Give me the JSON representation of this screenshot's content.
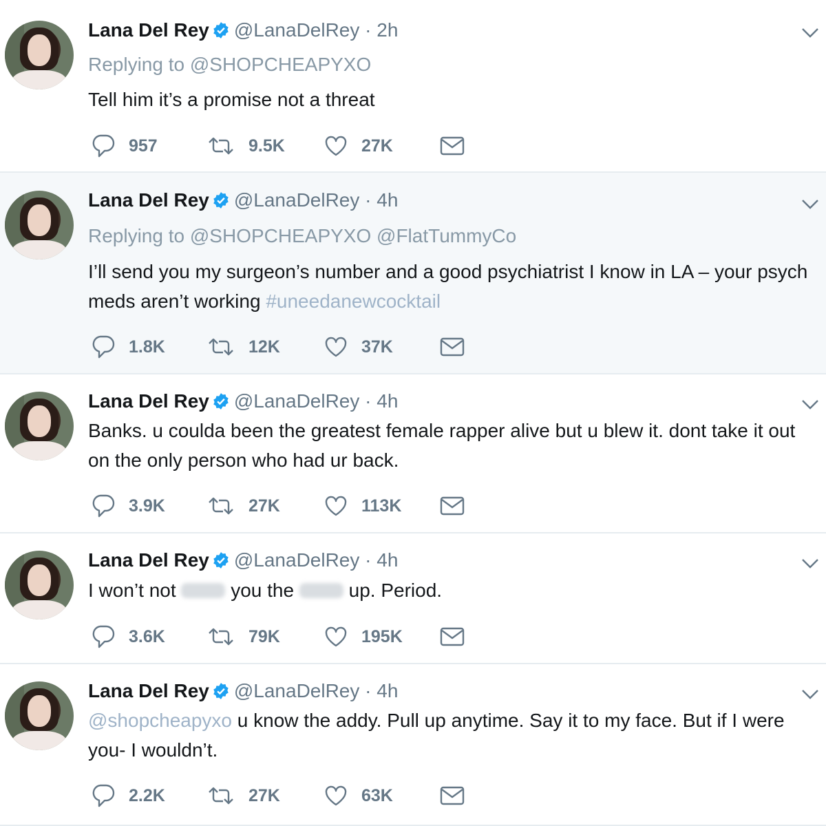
{
  "tweets": [
    {
      "name": "Lana Del Rey",
      "handle": "@LanaDelRey",
      "separator": "·",
      "time": "2h",
      "replying_prefix": "Replying to",
      "replying_to": "@SHOPCHEAPYXO",
      "text": "Tell him it’s a promise not a threat",
      "replies": "957",
      "retweets": "9.5K",
      "likes": "27K"
    },
    {
      "name": "Lana Del Rey",
      "handle": "@LanaDelRey",
      "separator": "·",
      "time": "4h",
      "replying_prefix": "Replying to",
      "replying_to": "@SHOPCHEAPYXO @FlatTummyCo",
      "text": "I’ll send you my surgeon’s number and a good psychiatrist I know in LA – your psych meds aren’t working",
      "hashtag": "#uneedanewcocktail",
      "replies": "1.8K",
      "retweets": "12K",
      "likes": "37K"
    },
    {
      "name": "Lana Del Rey",
      "handle": "@LanaDelRey",
      "separator": "·",
      "time": "4h",
      "text": "Banks. u coulda been the greatest female rapper alive but u blew it. dont take it out on the only person who had ur back.",
      "replies": "3.9K",
      "retweets": "27K",
      "likes": "113K"
    },
    {
      "name": "Lana Del Rey",
      "handle": "@LanaDelRey",
      "separator": "·",
      "time": "4h",
      "text_part1": "I won’t not",
      "text_part2": "you the",
      "text_part3": "up. Period.",
      "replies": "3.6K",
      "retweets": "79K",
      "likes": "195K"
    },
    {
      "name": "Lana Del Rey",
      "handle": "@LanaDelRey",
      "separator": "·",
      "time": "4h",
      "mention": "@shopcheapyxo",
      "text": "u know the addy. Pull up anytime. Say it to my face. But if I were you- I wouldn’t.",
      "replies": "2.2K",
      "retweets": "27K",
      "likes": "63K"
    }
  ],
  "icons": {
    "reply": "reply-icon",
    "retweet": "retweet-icon",
    "like": "heart-icon",
    "dm": "envelope-icon",
    "verified": "verified-badge-icon",
    "menu": "chevron-down-icon"
  },
  "colors": {
    "verified_blue": "#1da1f2",
    "muted_text": "#657786",
    "link_text": "#9fb3c8",
    "highlight_bg": "#f5f8fa"
  }
}
